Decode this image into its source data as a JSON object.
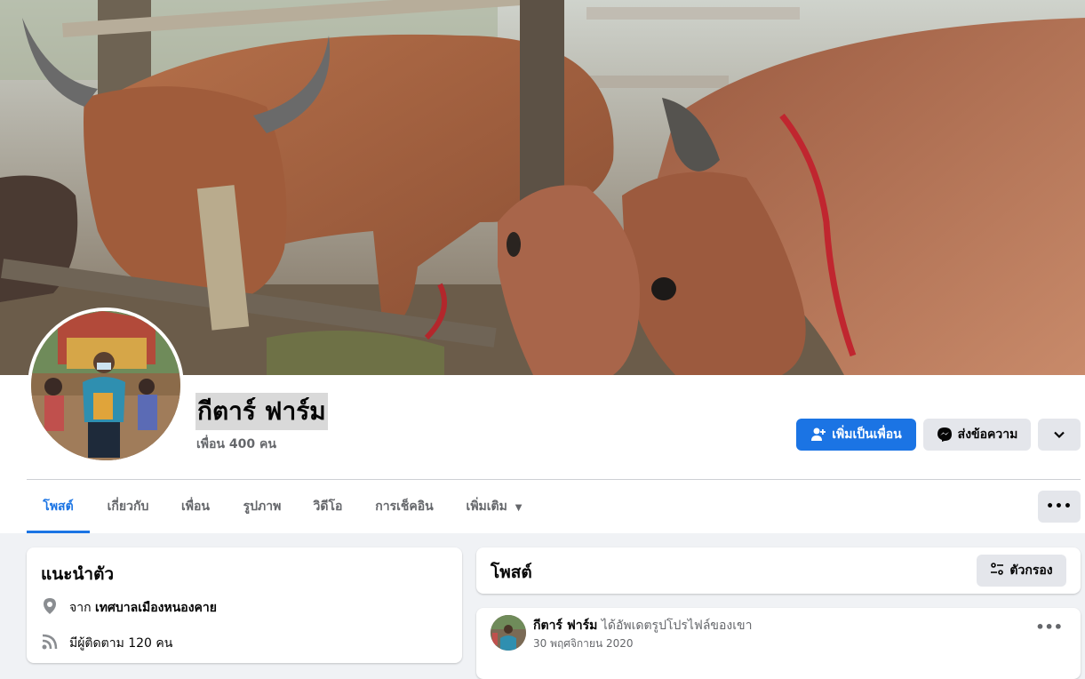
{
  "profile": {
    "name": "กีตาร์ ฟาร์ม",
    "friends": "เพื่อน 400 คน"
  },
  "actions": {
    "add_friend": "เพิ่มเป็นเพื่อน",
    "message": "ส่งข้อความ"
  },
  "tabs": [
    {
      "label": "โพสต์",
      "active": true
    },
    {
      "label": "เกี่ยวกับ"
    },
    {
      "label": "เพื่อน"
    },
    {
      "label": "รูปภาพ"
    },
    {
      "label": "วิดีโอ"
    },
    {
      "label": "การเช็คอิน"
    },
    {
      "label": "เพิ่มเติม"
    }
  ],
  "intro": {
    "title": "แนะนำตัว",
    "location_prefix": "จาก",
    "location": "เทศบาลเมืองหนองคาย",
    "followers": "มีผู้ติดตาม 120 คน"
  },
  "posts": {
    "title": "โพสต์",
    "filter_label": "ตัวกรอง",
    "first_post": {
      "author": "กีตาร์ ฟาร์ม",
      "action": "ได้อัพเดตรูปโปรไฟล์ของเขา",
      "date": "30 พฤศจิกายน 2020"
    }
  },
  "colors": {
    "accent": "#1b74e4",
    "background": "#f0f2f5",
    "secondary_button": "#e4e6eb",
    "muted_text": "#65676b"
  },
  "icons": {
    "add_friend": "person-plus-icon",
    "message": "messenger-icon",
    "dropdown": "chevron-down-icon",
    "more": "ellipsis-icon",
    "location": "map-pin-icon",
    "filter": "sliders-icon",
    "followers": "rss-icon"
  }
}
